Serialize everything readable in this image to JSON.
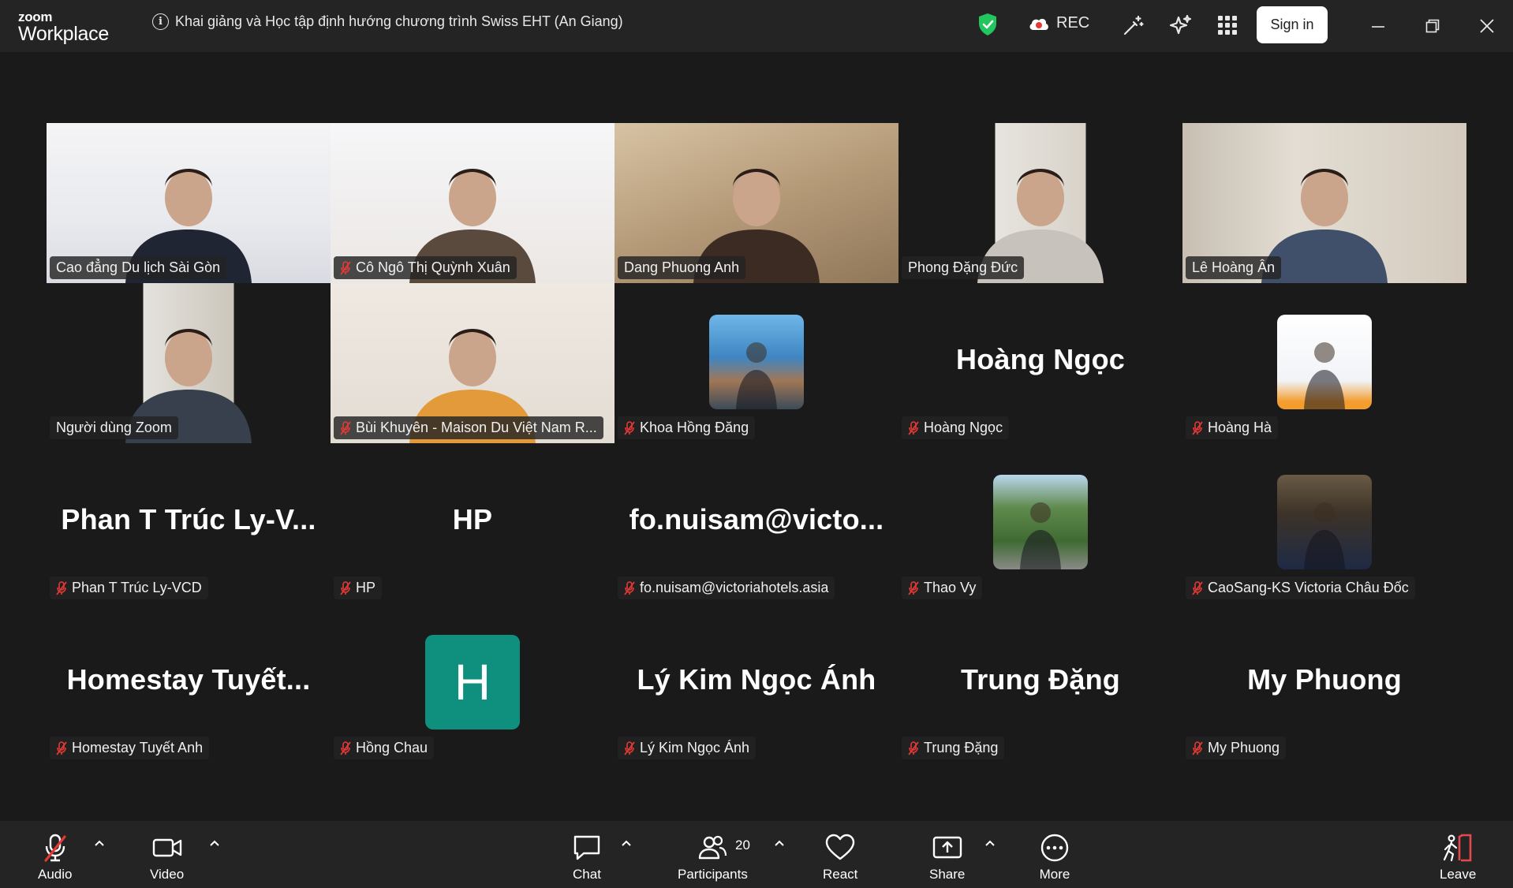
{
  "window": {
    "logo_top": "zoom",
    "logo_bottom": "Workplace",
    "meeting_title": "Khai giảng và Học tập định hướng chương trình Swiss EHT (An Giang)",
    "rec_label": "REC",
    "signin_label": "Sign in"
  },
  "gallery": {
    "rows": [
      [
        {
          "name": "Cao đẳng Du lịch Sài Gòn",
          "muted": false,
          "kind": "video",
          "active": true
        },
        {
          "name": "Cô Ngô Thị Quỳnh Xuân",
          "muted": true,
          "kind": "video"
        },
        {
          "name": "Dang Phuong Anh",
          "muted": false,
          "kind": "video"
        },
        {
          "name": "Phong Đặng Đức",
          "muted": false,
          "kind": "video"
        },
        {
          "name": "Lê Hoàng Ân",
          "muted": false,
          "kind": "video"
        }
      ],
      [
        {
          "name": "Người dùng Zoom",
          "muted": false,
          "kind": "video"
        },
        {
          "name": "Bùi Khuyên - Maison Du Việt Nam R...",
          "muted": true,
          "kind": "video"
        },
        {
          "name": "Khoa Hồng Đăng",
          "muted": true,
          "kind": "photo"
        },
        {
          "name": "Hoàng Ngọc",
          "muted": true,
          "kind": "text",
          "display": "Hoàng Ngọc"
        },
        {
          "name": "Hoàng Hà",
          "muted": true,
          "kind": "photo"
        }
      ],
      [
        {
          "name": "Phan T Trúc Ly-VCD",
          "muted": true,
          "kind": "text",
          "display": "Phan T Trúc Ly-V..."
        },
        {
          "name": "HP",
          "muted": true,
          "kind": "text",
          "display": "HP"
        },
        {
          "name": "fo.nuisam@victoriahotels.asia",
          "muted": true,
          "kind": "text",
          "display": "fo.nuisam@victo..."
        },
        {
          "name": "Thao Vy",
          "muted": true,
          "kind": "photo"
        },
        {
          "name": "CaoSang-KS Victoria Châu Đốc",
          "muted": true,
          "kind": "photo"
        }
      ],
      [
        {
          "name": "Homestay Tuyết Anh",
          "muted": true,
          "kind": "text",
          "display": "Homestay  Tuyết..."
        },
        {
          "name": "Hồng Chau",
          "muted": true,
          "kind": "initial",
          "display": "H"
        },
        {
          "name": "Lý Kim Ngọc Ánh",
          "muted": true,
          "kind": "text",
          "display": "Lý Kim Ngọc Ánh"
        },
        {
          "name": "Trung Đặng",
          "muted": true,
          "kind": "text",
          "display": "Trung Đặng"
        },
        {
          "name": "My Phuong",
          "muted": true,
          "kind": "text",
          "display": "My Phuong"
        }
      ]
    ]
  },
  "toolbar": {
    "audio": "Audio",
    "video": "Video",
    "chat": "Chat",
    "participants": "Participants",
    "participants_count": "20",
    "react": "React",
    "share": "Share",
    "more": "More",
    "leave": "Leave"
  },
  "colors": {
    "active_speaker": "#2fd66a",
    "mute_red": "#e53935",
    "initial_avatar": "#0f8f7e",
    "shield_green": "#22c55e",
    "leave_red": "#e5484d"
  }
}
